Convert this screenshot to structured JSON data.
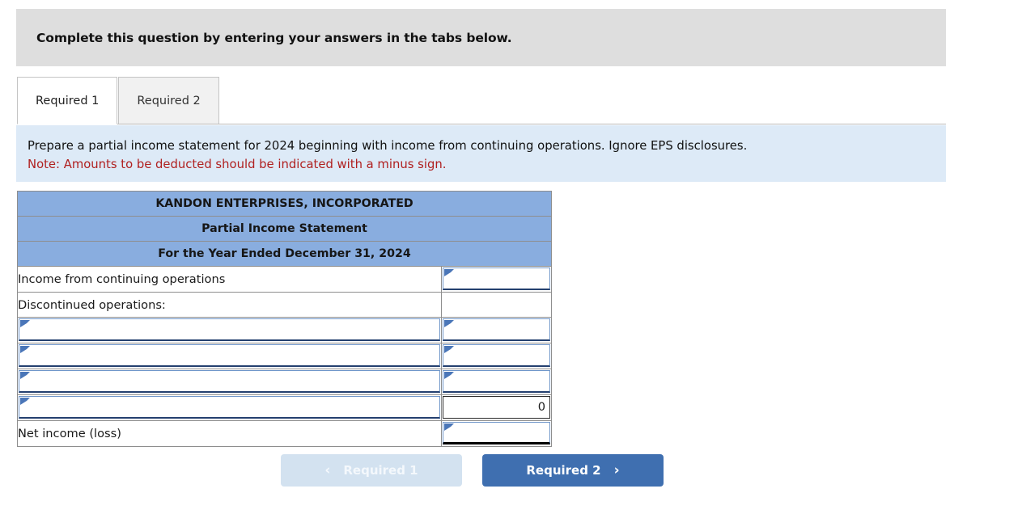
{
  "banner": {
    "text": "Complete this question by entering your answers in the tabs below."
  },
  "tabs": [
    {
      "label": "Required 1",
      "active": true
    },
    {
      "label": "Required 2",
      "active": false
    }
  ],
  "instructions": {
    "line1": "Prepare a partial income statement for 2024 beginning with income from continuing operations. Ignore EPS disclosures.",
    "note": "Note: Amounts to be deducted should be indicated with a minus sign."
  },
  "statement": {
    "title_lines": [
      "KANDON ENTERPRISES, INCORPORATED",
      "Partial Income Statement",
      "For the Year Ended December 31, 2024"
    ],
    "rows": [
      {
        "label": "Income from continuing operations",
        "label_type": "text",
        "amount": "",
        "amount_type": "input"
      },
      {
        "label": "Discontinued operations:",
        "label_type": "text",
        "amount": "",
        "amount_type": "plain"
      },
      {
        "label": "",
        "label_type": "input",
        "amount": "",
        "amount_type": "input"
      },
      {
        "label": "",
        "label_type": "input",
        "amount": "",
        "amount_type": "input"
      },
      {
        "label": "",
        "label_type": "input",
        "amount": "",
        "amount_type": "input"
      },
      {
        "label": "",
        "label_type": "input",
        "amount": "0",
        "amount_type": "total"
      },
      {
        "label": "Net income (loss)",
        "label_type": "text",
        "amount": "",
        "amount_type": "grand"
      }
    ]
  },
  "nav": {
    "prev_label": "Required 1",
    "prev_chevron": "‹",
    "next_label": "Required 2",
    "next_chevron": "›"
  },
  "colors": {
    "banner_bg": "#dedede",
    "instruction_bg": "#ddeaf7",
    "note_red": "#b02020",
    "table_header_bg": "#89addf",
    "field_border": "#6f96c9",
    "field_underline": "#24406f",
    "marker_triangle": "#4a76b8",
    "next_button_bg": "#3f6fb0",
    "prev_button_bg": "#d3e2f0"
  }
}
